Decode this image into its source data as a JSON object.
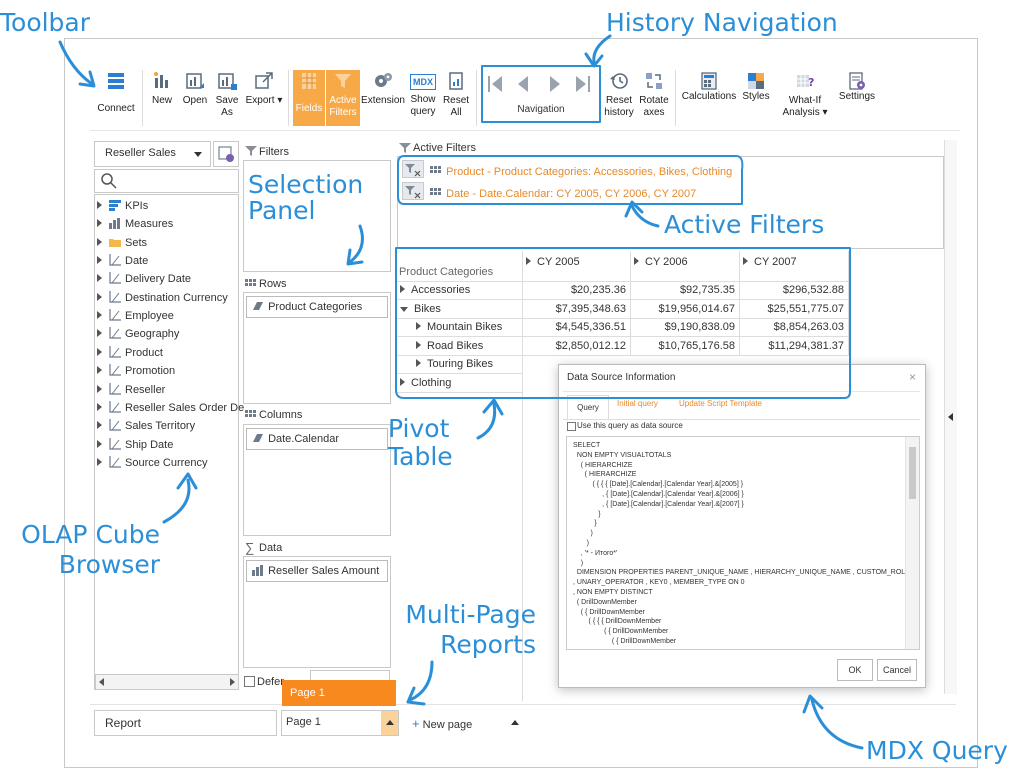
{
  "annotations": {
    "toolbar": "Toolbar",
    "history_navigation": "History Navigation",
    "selection_panel_1": "Selection",
    "selection_panel_2": "Panel",
    "active_filters": "Active Filters",
    "pivot_table_1": "Pivot",
    "pivot_table_2": "Table",
    "olap_1": "OLAP Cube",
    "olap_2": "Browser",
    "multipage_1": "Multi-Page",
    "multipage_2": "Reports",
    "mdx": "MDX Query"
  },
  "toolbar": {
    "connect": "Connect",
    "new": "New",
    "open": "Open",
    "save_as_1": "Save",
    "save_as_2": "As",
    "export": "Export ▾",
    "fields": "Fields",
    "active_filters_1": "Active",
    "active_filters_2": "Filters",
    "extension": "Extension",
    "show_query_1": "Show",
    "show_query_2": "query",
    "mdx_badge": "MDX",
    "reset_all_1": "Reset",
    "reset_all_2": "All",
    "navigation": "Navigation",
    "reset_history_1": "Reset",
    "reset_history_2": "history",
    "rotate_axes_1": "Rotate",
    "rotate_axes_2": "axes",
    "calculations": "Calculations",
    "styles": "Styles",
    "what_if_1": "What-If",
    "what_if_2": "Analysis ▾",
    "settings": "Settings"
  },
  "cube": {
    "selected": "Reseller Sales",
    "items": [
      "KPIs",
      "Measures",
      "Sets",
      "Date",
      "Delivery Date",
      "Destination Currency",
      "Employee",
      "Geography",
      "Product",
      "Promotion",
      "Reseller",
      "Reseller Sales Order De",
      "Sales Territory",
      "Ship Date",
      "Source Currency"
    ]
  },
  "selection": {
    "filters": "Filters",
    "rows": "Rows",
    "rows_field": "Product Categories",
    "columns": "Columns",
    "columns_field": "Date.Calendar",
    "data": "Data",
    "data_field": "Reseller Sales Amount",
    "defer": "Defer"
  },
  "active_filters": {
    "title": "Active Filters",
    "f1_label": "Product - Product Categories:",
    "f1_value": "Accessories, Bikes, Clothing",
    "f2_label": "Date - Date.Calendar:",
    "f2_value": "CY 2005, CY 2006, CY 2007"
  },
  "pivot": {
    "row_header": "Product Categories",
    "columns": [
      "CY 2005",
      "CY 2006",
      "CY 2007"
    ],
    "rows": [
      {
        "label": "Accessories",
        "values": [
          "$20,235.36",
          "$92,735.35",
          "$296,532.88"
        ]
      },
      {
        "label": "Bikes",
        "values": [
          "$7,395,348.63",
          "$19,956,014.67",
          "$25,551,775.07"
        ]
      },
      {
        "label": "Mountain Bikes",
        "values": [
          "$4,545,336.51",
          "$9,190,838.09",
          "$8,854,263.03"
        ]
      },
      {
        "label": "Road Bikes",
        "values": [
          "$2,850,012.12",
          "$10,765,176.58",
          "$11,294,381.37"
        ]
      },
      {
        "label": "Touring Bikes",
        "values": [
          "",
          "",
          ""
        ]
      },
      {
        "label": "Clothing",
        "values": [
          "",
          "",
          ""
        ]
      }
    ]
  },
  "dialog": {
    "title": "Data Source Information",
    "close": "×",
    "tabs": [
      "Query",
      "Initial query",
      "Update Script Template"
    ],
    "checkbox": "Use this query as data source",
    "ok": "OK",
    "cancel": "Cancel",
    "lines": [
      "SELECT",
      "  NON EMPTY VISUALTOTALS",
      "    ( HIERARCHIZE",
      "      ( HIERARCHIZE",
      "          ( { { { [Date].[Calendar].[Calendar Year].&[2005] }",
      "               , { [Date].[Calendar].[Calendar Year].&[2006] }",
      "               , { [Date].[Calendar].[Calendar Year].&[2007] }",
      "             }",
      "           }",
      "         )",
      "       )",
      "    , '* - Итого*'",
      "    )",
      "  DIMENSION PROPERTIES PARENT_UNIQUE_NAME , HIERARCHY_UNIQUE_NAME , CUSTOM_ROLLUP",
      ", UNARY_OPERATOR , KEY0 , MEMBER_TYPE ON 0",
      ", NON EMPTY DISTINCT",
      "  ( DrillDownMember",
      "    ( { DrillDownMember",
      "        ( { { { DrillDownMember",
      "                ( { DrillDownMember",
      "                    ( { DrillDownMember"
    ]
  },
  "footer": {
    "report": "Report",
    "page_select": "Page 1",
    "popup_page": "Page 1",
    "new_page": "New page"
  }
}
